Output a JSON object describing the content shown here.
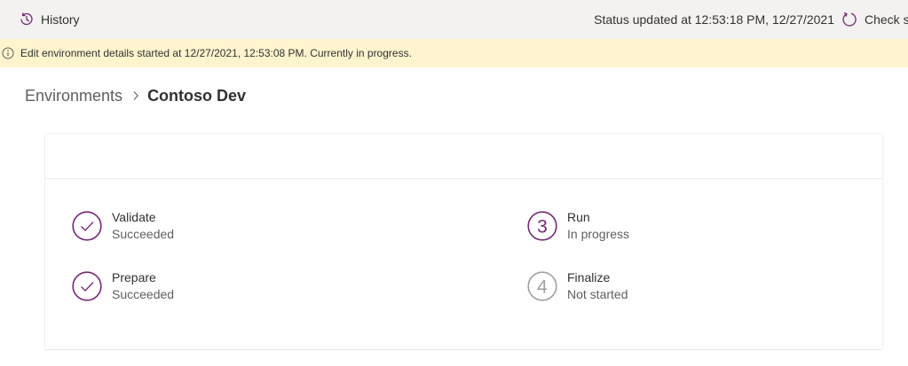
{
  "command_bar": {
    "history_label": "History",
    "status_text": "Status updated at 12:53:18 PM, 12/27/2021",
    "check_status_label": "Check st"
  },
  "banner": {
    "message": "Edit environment details started at 12/27/2021, 12:53:08 PM. Currently in progress."
  },
  "breadcrumb": {
    "parent": "Environments",
    "current": "Contoso Dev"
  },
  "steps": [
    {
      "label": "Validate",
      "status": "Succeeded",
      "icon": "checkmark-circle-icon"
    },
    {
      "label": "Prepare",
      "status": "Succeeded",
      "icon": "checkmark-circle-icon"
    },
    {
      "label": "Run",
      "status": "In progress",
      "icon": "step-number-icon",
      "number": "3"
    },
    {
      "label": "Finalize",
      "status": "Not started",
      "icon": "step-number-icon",
      "number": "4"
    }
  ],
  "colors": {
    "accent": "#742774",
    "inactive": "#a19f9d",
    "banner_bg": "#fff4ce",
    "command_bar_bg": "#f3f2f1"
  }
}
